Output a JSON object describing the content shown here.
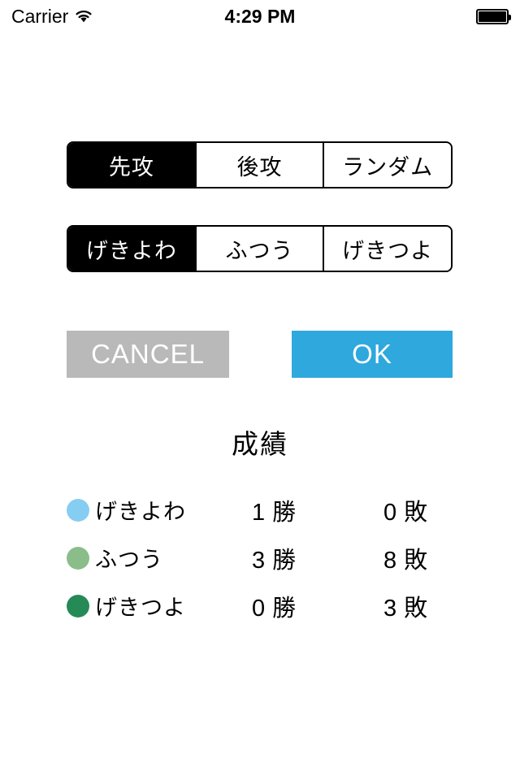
{
  "status_bar": {
    "carrier": "Carrier",
    "wifi_icon": "wifi-icon",
    "time": "4:29 PM",
    "battery_icon": "battery-full-icon"
  },
  "turn_selector": {
    "name": "turn-order-segmented-control",
    "options": [
      {
        "label": "先攻",
        "selected": true
      },
      {
        "label": "後攻",
        "selected": false
      },
      {
        "label": "ランダム",
        "selected": false
      }
    ]
  },
  "difficulty_selector": {
    "name": "difficulty-segmented-control",
    "options": [
      {
        "label": "げきよわ",
        "selected": true
      },
      {
        "label": "ふつう",
        "selected": false
      },
      {
        "label": "げきつよ",
        "selected": false
      }
    ]
  },
  "actions": {
    "cancel_label": "CANCEL",
    "cancel_color": "#b9b9b9",
    "ok_label": "OK",
    "ok_color": "#2fa8de"
  },
  "stats": {
    "title": "成績",
    "win_unit": "勝",
    "loss_unit": "敗",
    "rows": [
      {
        "label": "げきよわ",
        "color": "#86cdf2",
        "wins": "1",
        "losses": "0"
      },
      {
        "label": "ふつう",
        "color": "#8bbd8a",
        "wins": "3",
        "losses": "8"
      },
      {
        "label": "げきつよ",
        "color": "#258a56",
        "wins": "0",
        "losses": "3"
      }
    ]
  }
}
